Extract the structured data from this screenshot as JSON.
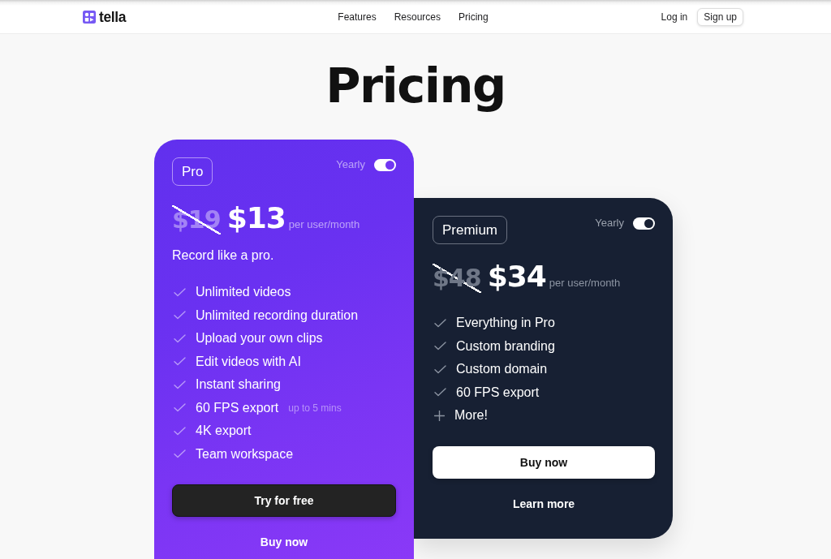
{
  "nav": {
    "logo": {
      "text": "tella"
    },
    "links": [
      {
        "label": "Features"
      },
      {
        "label": "Resources"
      },
      {
        "label": "Pricing"
      }
    ],
    "login": "Log in",
    "signup": "Sign up"
  },
  "title": "Pricing",
  "plans": [
    {
      "kind": "gradient",
      "name": "Pro",
      "billing": {
        "label": "Yearly",
        "on": true
      },
      "old_price": "$19",
      "price": "$13",
      "unit": "per user/month",
      "tagline": "Record like a pro.",
      "features": [
        {
          "kind": "check",
          "text": "Unlimited videos"
        },
        {
          "kind": "check",
          "text": "Unlimited recording duration"
        },
        {
          "kind": "check",
          "text": "Upload your own clips"
        },
        {
          "kind": "check",
          "text": "Edit videos with AI"
        },
        {
          "kind": "check",
          "text": "Instant sharing"
        },
        {
          "kind": "check",
          "text": "60 FPS export",
          "note": "up to 5 mins"
        },
        {
          "kind": "check",
          "text": "4K export"
        },
        {
          "kind": "check",
          "text": "Team workspace"
        }
      ],
      "primary_button": "Try for free",
      "secondary_link": "Buy now"
    },
    {
      "kind": "dark",
      "name": "Premium",
      "billing": {
        "label": "Yearly",
        "on": true
      },
      "old_price": "$48",
      "price": "$34",
      "unit": "per user/month",
      "features": [
        {
          "kind": "check",
          "text": "Everything in Pro"
        },
        {
          "kind": "check",
          "text": "Custom branding"
        },
        {
          "kind": "check",
          "text": "Custom domain"
        },
        {
          "kind": "check",
          "text": "60 FPS export"
        },
        {
          "kind": "plus",
          "text": "More!"
        }
      ],
      "primary_button": "Buy now",
      "secondary_link": "Learn more"
    }
  ]
}
